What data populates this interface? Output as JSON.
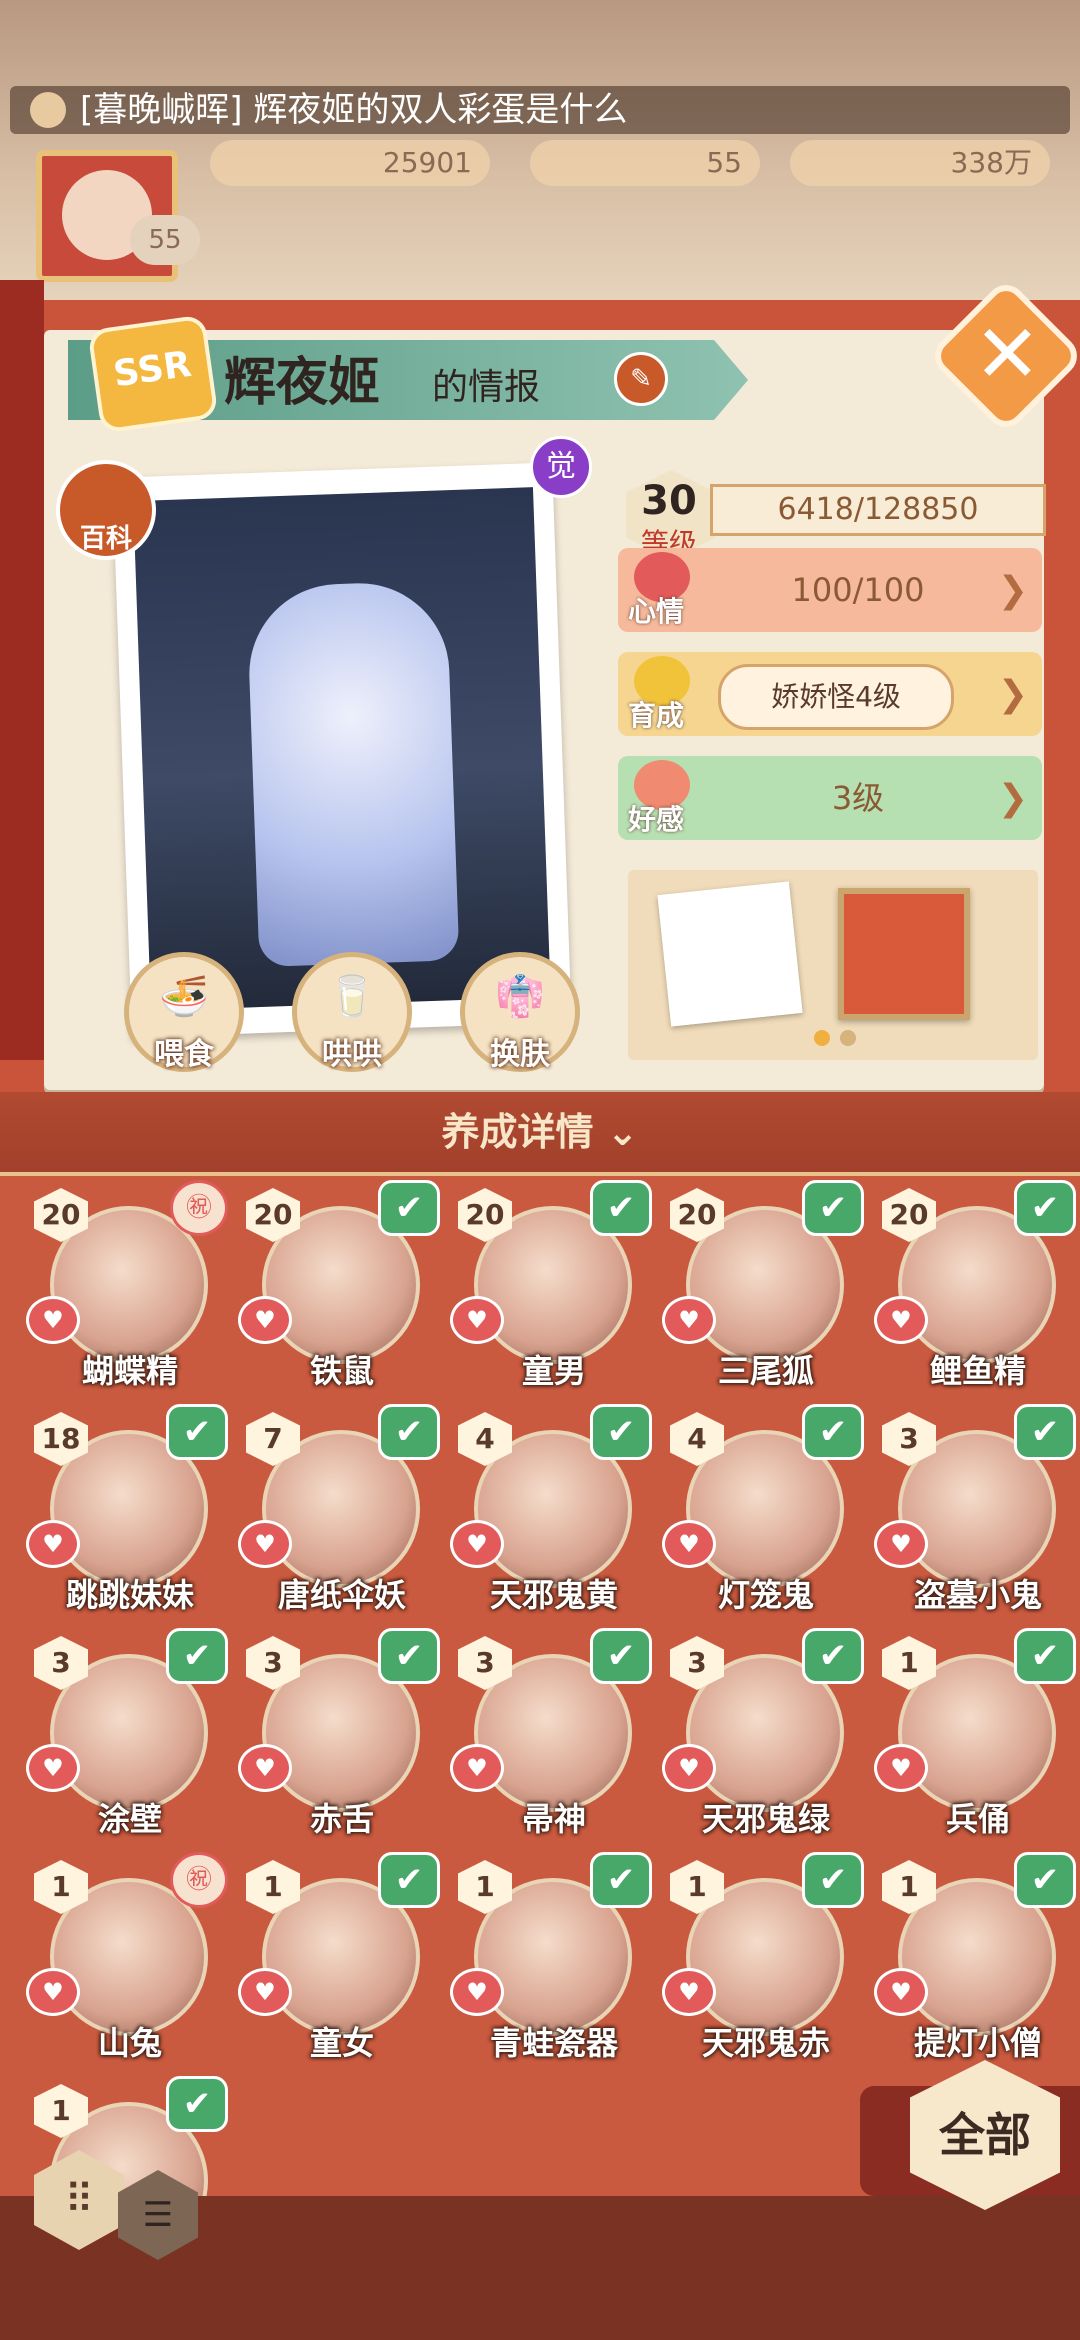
{
  "top": {
    "banner_text": "[暮晚峸晖] 辉夜姬的双人彩蛋是什么",
    "resources": [
      {
        "label": "25901",
        "icon": "jade-icon"
      },
      {
        "label": "55",
        "icon": "stamina-icon"
      },
      {
        "label": "338万",
        "icon": "coin-icon"
      }
    ],
    "player_level": "55"
  },
  "panel": {
    "rank": "SSR",
    "name": "辉夜姬",
    "name_suffix": "的情报",
    "encyclopedia_label": "百科",
    "awaken_label": "觉",
    "actions": [
      {
        "label": "喂食",
        "icon": "bowl-icon"
      },
      {
        "label": "哄哄",
        "icon": "milk-icon"
      },
      {
        "label": "换肤",
        "icon": "outfit-icon"
      }
    ],
    "level": "30",
    "level_label": "等级",
    "exp": "6418/128850",
    "stats": [
      {
        "name": "心情",
        "value": "100/100",
        "color": "#f7b99b",
        "icon_color": "#e35a5a"
      },
      {
        "name": "育成",
        "value": "娇娇怪4级",
        "color": "#f5d58f",
        "icon_color": "#f0c33a"
      },
      {
        "name": "好感",
        "value": "3级",
        "color": "#b7e0b2",
        "icon_color": "#f08a70"
      }
    ]
  },
  "section_title": "养成详情 ⌄",
  "shikigami": [
    {
      "name": "蝴蝶精",
      "level": "20",
      "mark": "seal",
      "seal_text": "㊗"
    },
    {
      "name": "铁鼠",
      "level": "20",
      "mark": "check"
    },
    {
      "name": "童男",
      "level": "20",
      "mark": "check"
    },
    {
      "name": "三尾狐",
      "level": "20",
      "mark": "check"
    },
    {
      "name": "鲤鱼精",
      "level": "20",
      "mark": "check"
    },
    {
      "name": "跳跳妹妹",
      "level": "18",
      "mark": "check"
    },
    {
      "name": "唐纸伞妖",
      "level": "7",
      "mark": "check"
    },
    {
      "name": "天邪鬼黄",
      "level": "4",
      "mark": "check"
    },
    {
      "name": "灯笼鬼",
      "level": "4",
      "mark": "check"
    },
    {
      "name": "盗墓小鬼",
      "level": "3",
      "mark": "check"
    },
    {
      "name": "涂壁",
      "level": "3",
      "mark": "check"
    },
    {
      "name": "赤舌",
      "level": "3",
      "mark": "check"
    },
    {
      "name": "帚神",
      "level": "3",
      "mark": "check"
    },
    {
      "name": "天邪鬼绿",
      "level": "3",
      "mark": "check"
    },
    {
      "name": "兵俑",
      "level": "1",
      "mark": "check"
    },
    {
      "name": "山兔",
      "level": "1",
      "mark": "seal",
      "seal_text": "㊗"
    },
    {
      "name": "童女",
      "level": "1",
      "mark": "check"
    },
    {
      "name": "青蛙瓷器",
      "level": "1",
      "mark": "check"
    },
    {
      "name": "天邪鬼赤",
      "level": "1",
      "mark": "check"
    },
    {
      "name": "提灯小僧",
      "level": "1",
      "mark": "check"
    },
    {
      "name": "",
      "level": "1",
      "mark": "check"
    }
  ],
  "all_button": "全部"
}
